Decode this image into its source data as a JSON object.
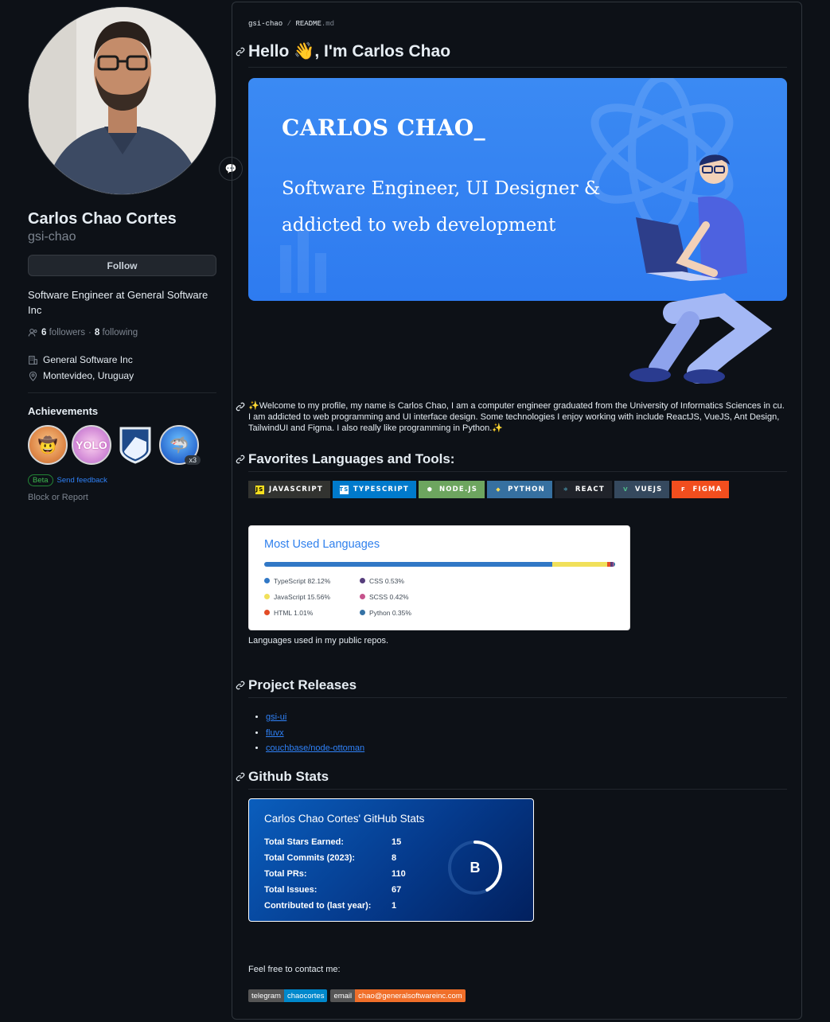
{
  "profile": {
    "full_name": "Carlos Chao Cortes",
    "login": "gsi-chao",
    "follow_label": "Follow",
    "bio": "Software Engineer at General Software Inc",
    "followers_count": "6",
    "followers_label": "followers",
    "separator": "·",
    "following_count": "8",
    "following_label": "following",
    "company": "General Software Inc",
    "location": "Montevideo, Uruguay"
  },
  "achievements": {
    "title": "Achievements",
    "multiplier": "x3",
    "beta_label": "Beta",
    "feedback_label": "Send feedback",
    "block_label": "Block or Report"
  },
  "readme": {
    "crumb_user": "gsi-chao",
    "crumb_sep": "/",
    "crumb_file": "README",
    "crumb_ext": ".md",
    "heading": "Hello 👋, I'm Carlos Chao",
    "banner_title": "CARLOS CHAO_",
    "banner_subtitle": "Software Engineer, UI Designer & addicted to web development",
    "welcome": "✨Welcome to my profile, my name is Carlos Chao, I am a computer engineer graduated from the University of Informatics Sciences in cu. I am addicted to web programming and UI interface design. Some technologies I enjoy working with include ReactJS, VueJS, Ant Design, TailwindUI and Figma. I also really like programming in Python.✨",
    "tools_heading": "Favorites Languages and Tools:",
    "languages_caption": "Languages used in my public repos.",
    "releases_heading": "Project Releases",
    "stats_heading": "Github Stats",
    "contact_text": "Feel free to contact me:"
  },
  "tools": [
    {
      "label": "JAVASCRIPT",
      "icon": "JS",
      "bg": "#323330",
      "icon_bg": "#f7df1e",
      "icon_fg": "#000000"
    },
    {
      "label": "TYPESCRIPT",
      "icon": "TS",
      "bg": "#007acc",
      "icon_bg": "#ffffff",
      "icon_fg": "#007acc"
    },
    {
      "label": "NODE.JS",
      "icon": "⬢",
      "bg": "#6da55f",
      "icon_bg": "transparent",
      "icon_fg": "#ffffff"
    },
    {
      "label": "PYTHON",
      "icon": "◆",
      "bg": "#3670a0",
      "icon_bg": "transparent",
      "icon_fg": "#ffdd54"
    },
    {
      "label": "REACT",
      "icon": "⚛",
      "bg": "#20232a",
      "icon_bg": "transparent",
      "icon_fg": "#61dafb"
    },
    {
      "label": "VUEJS",
      "icon": "V",
      "bg": "#35495e",
      "icon_bg": "transparent",
      "icon_fg": "#4fc08d"
    },
    {
      "label": "FIGMA",
      "icon": "F",
      "bg": "#f24e1e",
      "icon_bg": "transparent",
      "icon_fg": "#ffffff"
    }
  ],
  "languages": {
    "title": "Most Used Languages",
    "items": [
      {
        "name": "TypeScript",
        "percent": 82.12,
        "label": "TypeScript 82.12%",
        "color": "#3178c6"
      },
      {
        "name": "JavaScript",
        "percent": 15.56,
        "label": "JavaScript 15.56%",
        "color": "#f1e05a"
      },
      {
        "name": "HTML",
        "percent": 1.01,
        "label": "HTML 1.01%",
        "color": "#e34c26"
      },
      {
        "name": "CSS",
        "percent": 0.53,
        "label": "CSS 0.53%",
        "color": "#563d7c"
      },
      {
        "name": "SCSS",
        "percent": 0.42,
        "label": "SCSS 0.42%",
        "color": "#c6538c"
      },
      {
        "name": "Python",
        "percent": 0.35,
        "label": "Python 0.35%",
        "color": "#3572a5"
      }
    ]
  },
  "releases": [
    "gsi-ui",
    "fluvx",
    "couchbase/node-ottoman"
  ],
  "stats": {
    "title": "Carlos Chao Cortes' GitHub Stats",
    "rows": [
      {
        "label": "Total Stars Earned:",
        "value": "15"
      },
      {
        "label": "Total Commits (2023):",
        "value": "8"
      },
      {
        "label": "Total PRs:",
        "value": "110"
      },
      {
        "label": "Total Issues:",
        "value": "67"
      },
      {
        "label": "Contributed to (last year):",
        "value": "1"
      }
    ],
    "rank": "B",
    "rank_progress": 0.42
  },
  "contact": [
    {
      "label": "telegram",
      "value": "chaocortes",
      "color": "#0088cc"
    },
    {
      "label": "email",
      "value": "chao@generalsoftwareinc.com",
      "color": "#f06f2a"
    }
  ],
  "colors": {
    "page_bg": "#0d1117",
    "link": "#2f81f7",
    "banner": "#3b8af3"
  }
}
